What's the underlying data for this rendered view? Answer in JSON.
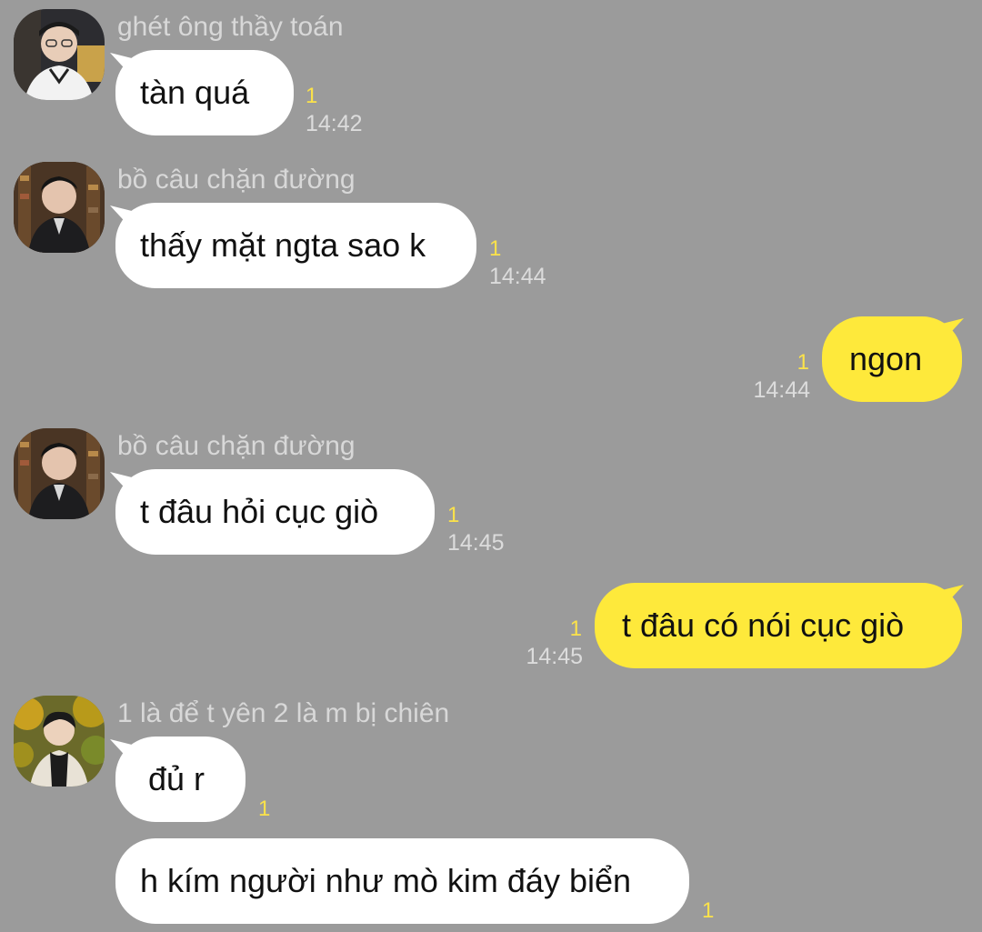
{
  "colors": {
    "background": "#9b9b9b",
    "incoming_bubble": "#ffffff",
    "outgoing_bubble": "#fee93b",
    "unread_counter": "#fbe24a",
    "sender_name": "#d8d8d8",
    "timestamp": "#dcdcdc"
  },
  "messages": [
    {
      "direction": "incoming",
      "sender": "ghét ông thầy toán",
      "avatar": "avatar-photo-1",
      "text": "tàn quá",
      "unread": "1",
      "time": "14:42"
    },
    {
      "direction": "incoming",
      "sender": "bồ câu chặn đường",
      "avatar": "avatar-photo-2",
      "text": "thấy mặt ngta sao k",
      "unread": "1",
      "time": "14:44"
    },
    {
      "direction": "outgoing",
      "text": "ngon",
      "unread": "1",
      "time": "14:44"
    },
    {
      "direction": "incoming",
      "sender": "bồ câu chặn đường",
      "avatar": "avatar-photo-2",
      "text": "t đâu hỏi cục giò",
      "unread": "1",
      "time": "14:45"
    },
    {
      "direction": "outgoing",
      "text": "t đâu có nói cục giò",
      "unread": "1",
      "time": "14:45"
    },
    {
      "direction": "incoming",
      "sender": "1 là để t yên 2 là m bị chiên",
      "avatar": "avatar-photo-3",
      "text": "đủ r",
      "unread": "1",
      "time": ""
    },
    {
      "direction": "incoming",
      "text": "h kím người như mò kim đáy biển",
      "unread": "1",
      "time": ""
    }
  ]
}
